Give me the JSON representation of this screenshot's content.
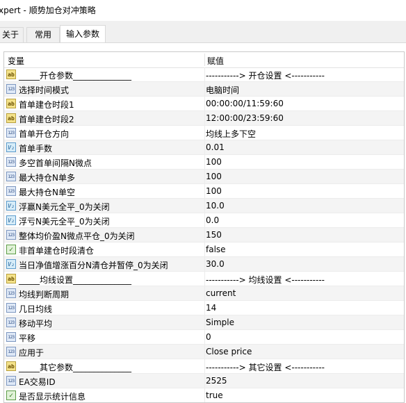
{
  "window": {
    "title": "xpert - 顺势加仓对冲策略"
  },
  "tabs": [
    {
      "label": "关于"
    },
    {
      "label": "常用"
    },
    {
      "label": "输入参数"
    }
  ],
  "grid": {
    "header": {
      "col1": "变量",
      "col2": "赋值"
    },
    "rows": [
      {
        "icon": "ab",
        "name": "_____开仓参数______________",
        "value": "-----------> 开仓设置 <-----------"
      },
      {
        "icon": "123",
        "name": "选择时间模式",
        "value": "电脑时间"
      },
      {
        "icon": "ab",
        "name": "首单建仓时段1",
        "value": "00:00:00/11:59:60"
      },
      {
        "icon": "ab",
        "name": "首单建仓时段2",
        "value": "12:00:00/23:59:60"
      },
      {
        "icon": "123",
        "name": "首单开仓方向",
        "value": "均线上多下空"
      },
      {
        "icon": "v",
        "name": "首单手数",
        "value": "0.01"
      },
      {
        "icon": "123",
        "name": "多空首单间隔N微点",
        "value": "100"
      },
      {
        "icon": "123",
        "name": "最大持仓N单多",
        "value": "100"
      },
      {
        "icon": "123",
        "name": "最大持仓N单空",
        "value": "100"
      },
      {
        "icon": "v",
        "name": "浮赢N美元全平_0为关闭",
        "value": "10.0"
      },
      {
        "icon": "v",
        "name": "浮亏N美元全平_0为关闭",
        "value": "0.0"
      },
      {
        "icon": "123",
        "name": "整体均价盈N微点平仓_0为关闭",
        "value": "150"
      },
      {
        "icon": "bool",
        "name": "非首单建仓时段清仓",
        "value": "false"
      },
      {
        "icon": "v",
        "name": "当日净值增涨百分N清仓并暂停_0为关闭",
        "value": "30.0"
      },
      {
        "icon": "ab",
        "name": "_____均线设置______________",
        "value": "-----------> 均线设置 <-----------"
      },
      {
        "icon": "123",
        "name": "均线判断周期",
        "value": "current"
      },
      {
        "icon": "123",
        "name": "几日均线",
        "value": "14"
      },
      {
        "icon": "123",
        "name": "移动平均",
        "value": "Simple"
      },
      {
        "icon": "123",
        "name": "平移",
        "value": "0"
      },
      {
        "icon": "123",
        "name": "应用于",
        "value": "Close price"
      },
      {
        "icon": "ab",
        "name": "_____其它参数______________",
        "value": "-----------> 其它设置 <-----------"
      },
      {
        "icon": "123",
        "name": "EA交易ID",
        "value": "2525"
      },
      {
        "icon": "bool",
        "name": "是否显示统计信息",
        "value": "true"
      }
    ]
  }
}
